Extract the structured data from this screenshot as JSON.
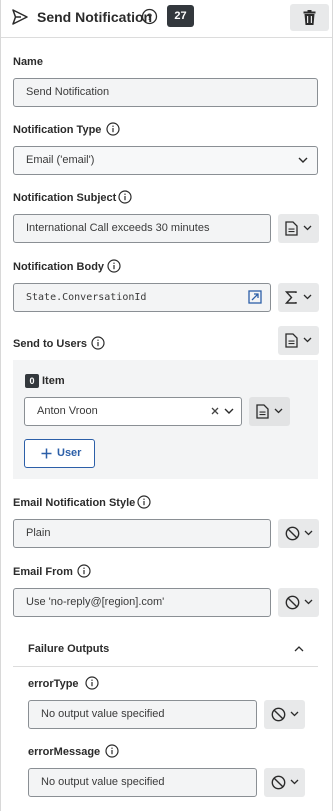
{
  "header": {
    "title": "Send Notification",
    "badge": "27"
  },
  "fields": {
    "name": {
      "label": "Name",
      "value": "Send Notification"
    },
    "notification_type": {
      "label": "Notification Type",
      "value": "Email ('email')"
    },
    "notification_subject": {
      "label": "Notification Subject",
      "value": "International Call exceeds 30 minutes"
    },
    "notification_body": {
      "label": "Notification Body",
      "value": "State.ConversationId"
    },
    "send_to_users": {
      "label": "Send to Users",
      "item_count": "0",
      "item_label": "Item",
      "user_value": "Anton Vroon",
      "add_user_label": "User"
    },
    "email_style": {
      "label": "Email Notification Style",
      "value": "Plain"
    },
    "email_from": {
      "label": "Email From",
      "value": "Use 'no-reply@[region].com'"
    }
  },
  "failure_outputs": {
    "title": "Failure Outputs",
    "error_type": {
      "label": "errorType",
      "value": "No output value specified"
    },
    "error_message": {
      "label": "errorMessage",
      "value": "No output value specified"
    }
  },
  "colors": {
    "accent": "#2c5fa8",
    "badge_bg": "#33383d"
  }
}
